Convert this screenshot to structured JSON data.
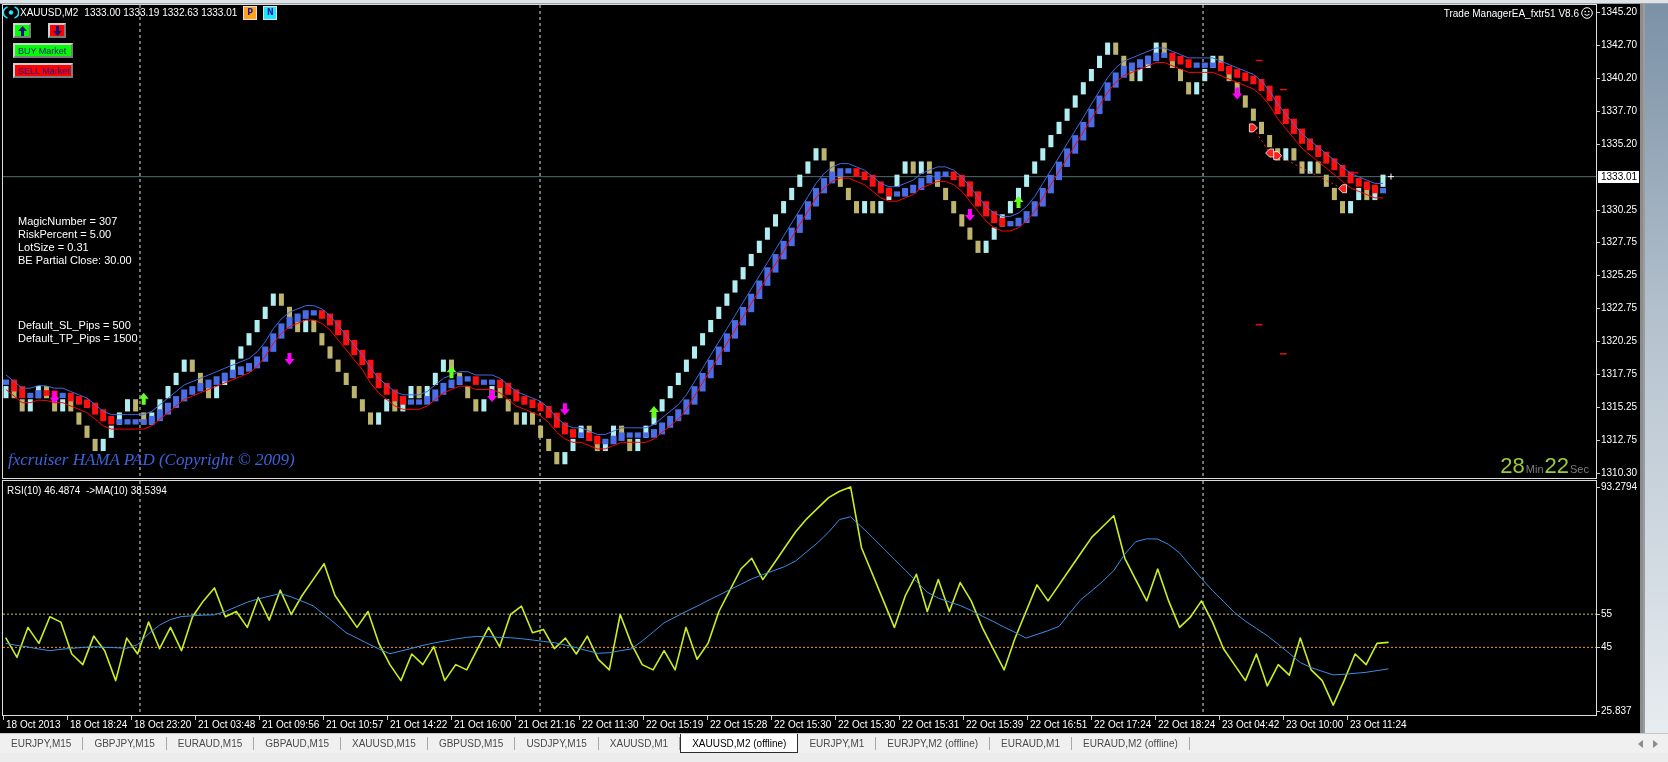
{
  "header": {
    "symbol": "XAUUSD,M2",
    "quote": "1333.00 1333.19 1332.63 1333.01",
    "badges": [
      {
        "label": "P",
        "color": "#ffa31a"
      },
      {
        "label": "N",
        "color": "#19e6ff"
      }
    ]
  },
  "order_buttons": [
    {
      "kind": "arrow_up",
      "color": "#00ff00"
    },
    {
      "kind": "arrow_down",
      "color": "#ff0000"
    },
    {
      "kind": "text",
      "label": "BUY Market",
      "color": "#00ff00"
    },
    {
      "kind": "text",
      "label": "SELL Market",
      "color": "#ff0000"
    }
  ],
  "ea_label": "Trade ManagerEA_fxtr51 V8.6",
  "settings": [
    "MagicNumber = 307",
    "RiskPercent = 5.00",
    "LotSize = 0.31",
    "BE Partial Close: 30.00"
  ],
  "default_pips": [
    "Default_SL_Pips = 500",
    "Default_TP_Pips = 1500"
  ],
  "indicator_credit": "fxcruiser HAMA PAD (Copyright © 2009)",
  "bar_timer": {
    "minutes": "28",
    "minutes_unit": "Min",
    "seconds": "22",
    "seconds_unit": "Sec"
  },
  "price_axis": [
    {
      "label": "1345.20",
      "current": false
    },
    {
      "label": "1342.70",
      "current": false
    },
    {
      "label": "1340.20",
      "current": false
    },
    {
      "label": "1337.70",
      "current": false
    },
    {
      "label": "1335.20",
      "current": false
    },
    {
      "label": "1333.01",
      "current": true
    },
    {
      "label": "1330.25",
      "current": false
    },
    {
      "label": "1327.75",
      "current": false
    },
    {
      "label": "1325.25",
      "current": false
    },
    {
      "label": "1322.75",
      "current": false
    },
    {
      "label": "1320.25",
      "current": false
    },
    {
      "label": "1317.75",
      "current": false
    },
    {
      "label": "1315.25",
      "current": false
    },
    {
      "label": "1312.75",
      "current": false
    },
    {
      "label": "1310.30",
      "current": false
    }
  ],
  "rsi_panel": {
    "label": "RSI(10) 46.4874  ->MA(10) 38.5394",
    "chart_data": {
      "type": "line",
      "ylim": [
        24.33,
        95.39
      ],
      "yticks": [
        {
          "value": 93.2794,
          "label": "93.2794"
        },
        {
          "value": 55,
          "label": "55"
        },
        {
          "value": 45,
          "label": "45"
        },
        {
          "value": 25.837,
          "label": "25.837"
        }
      ],
      "series": [
        {
          "color": "#c8f020",
          "values": [
            47.8,
            42.0,
            51.0,
            46.2,
            54.2,
            52.6,
            43.0,
            39.8,
            48.4,
            44.0,
            35.0,
            47.8,
            43.0,
            52.6,
            44.6,
            51.0,
            44.0,
            54.2,
            59.0,
            62.9,
            54.2,
            55.8,
            51.0,
            60.0,
            53.2,
            62.2,
            54.9,
            60.6,
            65.4,
            70.2,
            60.6,
            55.8,
            51.0,
            55.8,
            46.2,
            39.8,
            35.0,
            43.0,
            39.8,
            45.2,
            35.0,
            39.8,
            38.2,
            44.6,
            51.0,
            45.2,
            54.9,
            57.4,
            49.4,
            50.4,
            44.6,
            47.8,
            43.0,
            48.4,
            41.4,
            38.2,
            54.9,
            46.2,
            39.8,
            38.2,
            44.0,
            38.2,
            51.0,
            41.4,
            46.2,
            55.8,
            62.2,
            68.6,
            71.8,
            65.4,
            70.2,
            75.0,
            79.8,
            83.7,
            86.9,
            90.1,
            92.0,
            93.3,
            75.0,
            67.0,
            59.0,
            51.0,
            60.6,
            67.0,
            55.8,
            65.4,
            55.8,
            64.5,
            59.0,
            51.0,
            44.6,
            38.2,
            47.8,
            55.8,
            63.8,
            59.0,
            63.8,
            68.6,
            73.4,
            78.2,
            81.4,
            84.6,
            71.8,
            65.4,
            59.0,
            68.6,
            59.0,
            51.0,
            54.2,
            59.0,
            52.6,
            44.6,
            39.8,
            35.0,
            43.0,
            33.4,
            39.8,
            36.6,
            47.8,
            38.2,
            35.0,
            27.6,
            35.0,
            43.0,
            39.8,
            46.2,
            46.5
          ]
        },
        {
          "color": "#3a8ee6",
          "values": [
            46.2,
            45.6,
            45.1,
            44.5,
            44.0,
            44.4,
            44.7,
            45.0,
            45.2,
            45.0,
            44.9,
            44.7,
            45.8,
            49.1,
            51.7,
            53.4,
            54.3,
            54.5,
            54.7,
            54.8,
            55.8,
            57.2,
            58.6,
            59.6,
            60.4,
            61.2,
            60.2,
            58.9,
            57.5,
            54.9,
            52.2,
            49.4,
            47.8,
            46.1,
            44.5,
            43.1,
            43.9,
            44.7,
            45.6,
            46.3,
            46.9,
            47.5,
            48.0,
            48.3,
            48.2,
            48.0,
            47.9,
            47.6,
            47.2,
            46.8,
            46.4,
            45.7,
            44.9,
            44.0,
            43.2,
            43.4,
            44.0,
            44.5,
            46.9,
            49.6,
            52.4,
            54.1,
            55.8,
            57.4,
            59.1,
            60.7,
            62.4,
            64.0,
            65.6,
            66.9,
            68.1,
            69.3,
            71.0,
            73.8,
            76.5,
            79.7,
            83.5,
            84.3,
            81.3,
            78.1,
            74.8,
            71.5,
            68.2,
            64.9,
            61.6,
            59.8,
            58.7,
            57.6,
            56.1,
            54.4,
            52.8,
            51.1,
            49.5,
            47.8,
            48.9,
            50.0,
            51.3,
            55.4,
            59.4,
            62.1,
            64.9,
            68.1,
            73.1,
            76.8,
            77.7,
            77.6,
            76.0,
            73.4,
            69.5,
            65.7,
            62.1,
            58.8,
            55.5,
            52.9,
            50.7,
            48.5,
            45.9,
            43.2,
            40.4,
            38.9,
            37.8,
            36.7,
            36.9,
            37.2,
            37.5,
            38.0,
            38.5
          ]
        }
      ],
      "ref_lines": [
        {
          "axis": "y",
          "value": 55,
          "color": "#c8c85a"
        },
        {
          "axis": "y",
          "value": 45,
          "color": "#ff9a1a"
        }
      ]
    }
  },
  "time_axis": [
    "18 Oct 2013",
    "18 Oct 18:24",
    "18 Oct 23:20",
    "21 Oct 03:48",
    "21 Oct 09:56",
    "21 Oct 10:57",
    "21 Oct 14:22",
    "21 Oct 16:00",
    "21 Oct 21:16",
    "22 Oct 11:30",
    "22 Oct 15:19",
    "22 Oct 15:28",
    "22 Oct 15:30",
    "22 Oct 15:30",
    "22 Oct 15:31",
    "22 Oct 15:39",
    "22 Oct 16:51",
    "22 Oct 17:24",
    "22 Oct 18:24",
    "23 Oct 04:42",
    "23 Oct 10:00",
    "23 Oct 11:24"
  ],
  "tabs": [
    {
      "label": "EURJPY,M15",
      "selected": false
    },
    {
      "label": "GBPJPY,M15",
      "selected": false
    },
    {
      "label": "EURAUD,M15",
      "selected": false
    },
    {
      "label": "GBPAUD,M15",
      "selected": false
    },
    {
      "label": "XAUUSD,M15",
      "selected": false
    },
    {
      "label": "GBPUSD,M15",
      "selected": false
    },
    {
      "label": "USDJPY,M15",
      "selected": false
    },
    {
      "label": "XAUUSD,M1",
      "selected": false
    },
    {
      "label": "XAUUSD,M2 (offline)",
      "selected": true
    },
    {
      "label": "EURJPY,M1",
      "selected": false
    },
    {
      "label": "EURJPY,M2 (offline)",
      "selected": false
    },
    {
      "label": "EURAUD,M1",
      "selected": false
    },
    {
      "label": "EURAUD,M2 (offline)",
      "selected": false
    }
  ]
}
